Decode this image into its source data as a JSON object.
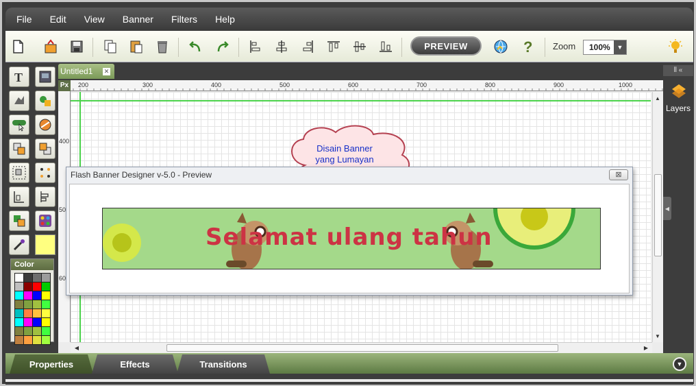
{
  "menu": [
    "File",
    "Edit",
    "View",
    "Banner",
    "Filters",
    "Help"
  ],
  "toolbar": {
    "preview_label": "PREVIEW",
    "zoom_label": "Zoom",
    "zoom_value": "100%",
    "icons": [
      "new-document-icon",
      "open-icon",
      "save-icon",
      "copy-icon",
      "paste-icon",
      "delete-icon",
      "undo-icon",
      "redo-icon",
      "align-left-icon",
      "align-center-icon",
      "align-right-icon",
      "align-top-icon",
      "align-middle-icon",
      "align-bottom-icon",
      "web-icon",
      "help-icon",
      "tip-icon"
    ]
  },
  "document": {
    "tab_title": "Untitled1",
    "ruler_unit": "Px"
  },
  "rulers": {
    "horizontal": [
      "200",
      "300",
      "400",
      "500",
      "600",
      "700",
      "800",
      "900",
      "1000"
    ],
    "vertical": [
      "400",
      "50",
      "60"
    ]
  },
  "color_panel": {
    "title": "Color",
    "swatches": [
      "#ffffff",
      "#3a3a3a",
      "#6e6e6e",
      "#9c9c9c",
      "#c0c0c0",
      "#8b0000",
      "#ff0000",
      "#00cc00",
      "#00ffff",
      "#ff00ff",
      "#0000ff",
      "#ffff00",
      "#808040",
      "#80a040",
      "#a0c040",
      "#40ff40",
      "#00c0c0",
      "#ff8040",
      "#ffc040",
      "#ffff40",
      "#00ffff",
      "#ff00ff",
      "#0000ff",
      "#ffff00",
      "#808040",
      "#80a040",
      "#a0c040",
      "#40ff40",
      "#c08040",
      "#ffa040",
      "#e0e040",
      "#a0ff40"
    ],
    "selected_fill": "#ffff80"
  },
  "callout": {
    "line1": "Disain Banner",
    "line2": "yang Lumayan"
  },
  "preview_window": {
    "title": "Flash Banner Designer v-5.0 - Preview",
    "close_glyph": "⊠",
    "banner_text": "Selamat ulang tahun"
  },
  "right_panel": {
    "layers_label": "Layers"
  },
  "bottom_tabs": [
    "Properties",
    "Effects",
    "Transitions"
  ]
}
